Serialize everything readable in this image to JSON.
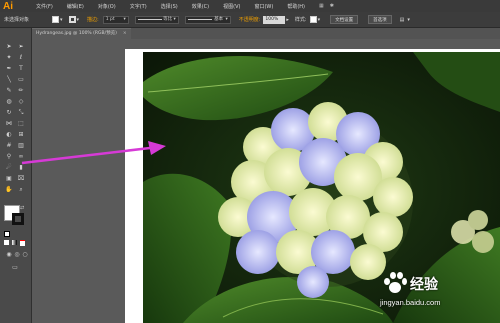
{
  "app": {
    "logo": "Ai"
  },
  "menu": [
    "文件(F)",
    "编辑(E)",
    "对象(O)",
    "文字(T)",
    "选择(S)",
    "效果(C)",
    "视图(V)",
    "窗口(W)",
    "帮助(H)"
  ],
  "control": {
    "selection": "未选择对象",
    "stroke_label": "描边:",
    "stroke_weight": "1 pt",
    "profile": "等比",
    "brush": "基本",
    "opacity_label": "不透明度:",
    "opacity": "100%",
    "style_label": "样式:",
    "doc_setup": "文档设置",
    "preferences": "首选项"
  },
  "document": {
    "tab_title": "Hydrangeas.jpg @ 100% (RGB/预览)",
    "close": "×"
  },
  "watermark": {
    "brand": "Bai",
    "brand_cn": "经验",
    "url": "jingyan.baidu.com"
  },
  "colors": {
    "accent": "#ff9a00",
    "arrow": "#d63ad6",
    "menubar": "#3a3a3a",
    "canvas": "#5a5a5a"
  }
}
